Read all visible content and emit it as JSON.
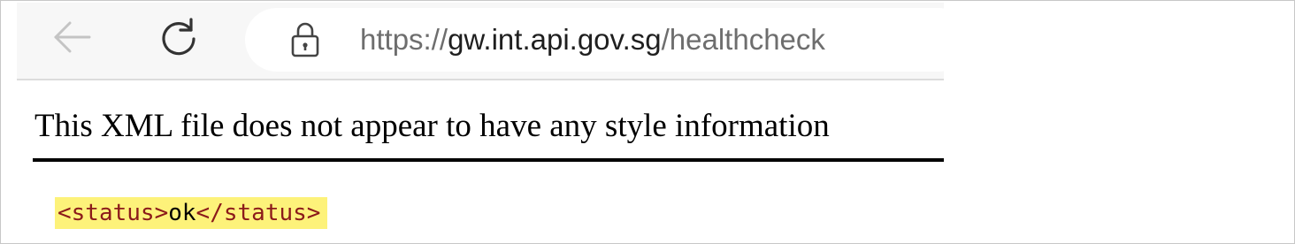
{
  "browser": {
    "address_bar": {
      "scheme": "https://",
      "host": "gw.int.api.gov.sg",
      "path": "/healthcheck"
    },
    "icons": {
      "back": "back-arrow-icon",
      "reload": "reload-icon",
      "lock": "lock-icon"
    }
  },
  "page": {
    "notice": "This XML file does not appear to have any style information",
    "xml": {
      "open_tag": "<status>",
      "content": "ok",
      "close_tag": "</status>"
    }
  },
  "colors": {
    "highlight": "#fdf27a",
    "tag": "#8b1a1a",
    "toolbar": "#f7f7f7"
  }
}
